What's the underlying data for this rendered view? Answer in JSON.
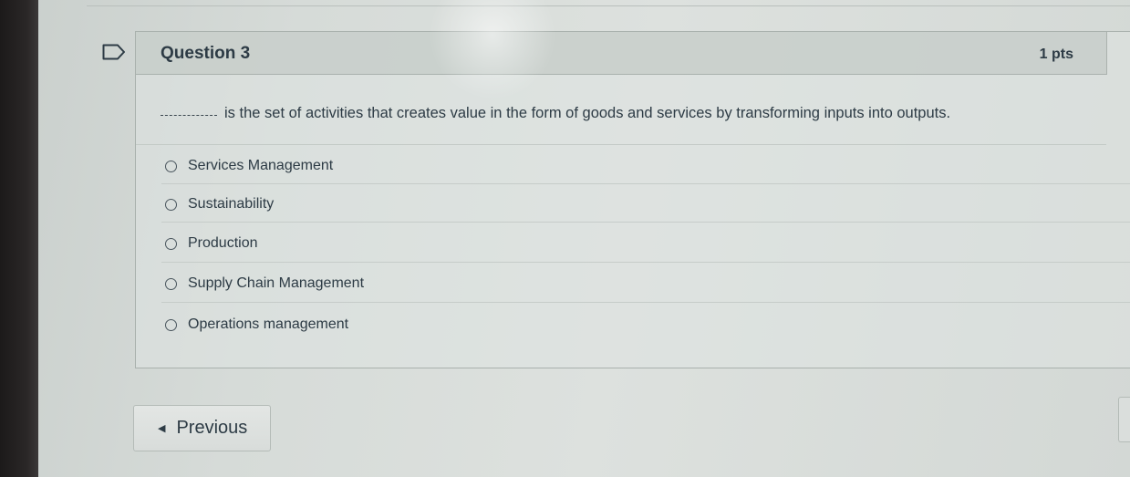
{
  "question": {
    "title": "Question 3",
    "points": "1 pts",
    "blank": "________",
    "text": "is the set of activities that creates value in the form of goods and services by transforming inputs into outputs.",
    "answers": [
      {
        "label": "Services Management"
      },
      {
        "label": "Sustainability"
      },
      {
        "label": "Production"
      },
      {
        "label": "Supply Chain Management"
      },
      {
        "label": "Operations management"
      }
    ]
  },
  "navigation": {
    "previous_label": "Previous",
    "previous_icon": "caret-left-icon"
  },
  "colors": {
    "text": "#2d3b45",
    "header_bg": "#c4cbc7",
    "page_bg": "#d6dbd8"
  }
}
